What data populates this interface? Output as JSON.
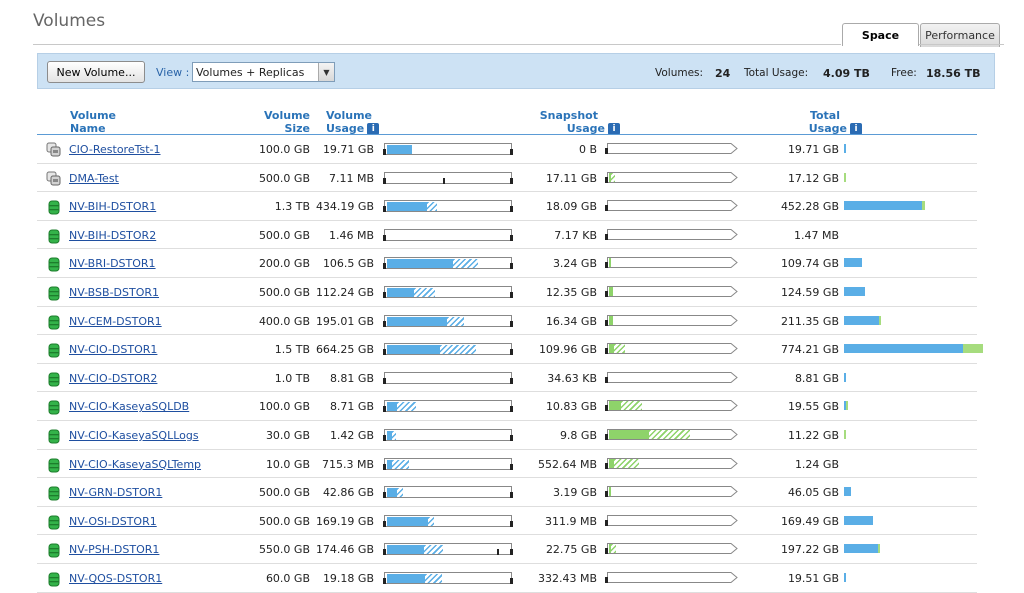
{
  "page": {
    "title": "Volumes"
  },
  "tabs": [
    {
      "label": "Space",
      "active": true
    },
    {
      "label": "Performance",
      "active": false
    }
  ],
  "toolbar": {
    "new_volume_label": "New Volume...",
    "view_label": "View :",
    "view_value": "Volumes + Replicas",
    "volumes_label": "Volumes:",
    "volumes_count": "24",
    "total_usage_label": "Total Usage:",
    "total_usage_value": "4.09 TB",
    "free_label": "Free:",
    "free_value": "18.56 TB"
  },
  "columns": {
    "name_l1": "Volume",
    "name_l2": "Name",
    "size_l1": "Volume",
    "size_l2": "Size",
    "usage_l1": "Volume",
    "usage_l2": "Usage",
    "snap_l1": "Snapshot",
    "snap_l2": "Usage",
    "total_l1": "Total",
    "total_l2": "Usage",
    "info_glyph": "i"
  },
  "colors": {
    "volume_bar": "#5aaee6",
    "snapshot_bar": "#8ed36a",
    "total_snapshot": "#a6dc7e",
    "header_text": "#2a73b8",
    "link": "#1f4fa0"
  },
  "rows": [
    {
      "icon": "replica-icon",
      "name": "CIO-RestoreTst-1",
      "size": "100.0 GB",
      "usage": "19.71 GB",
      "vol_used": 0.2,
      "vol_hatch": 0,
      "snap_usage": "0 B",
      "snap_used": 0,
      "snap_hatch": 0,
      "total": "19.71 GB",
      "total_vol": 0.017,
      "total_snap": 0
    },
    {
      "icon": "replica-icon",
      "name": "DMA-Test",
      "size": "500.0 GB",
      "usage": "7.11 MB",
      "vol_used": 0.0,
      "vol_hatch": 0,
      "vol_mark": 0.47,
      "snap_usage": "17.11 GB",
      "snap_used": 0.02,
      "snap_hatch": 0.03,
      "total": "17.12 GB",
      "total_vol": 0,
      "total_snap": 0.016
    },
    {
      "icon": "volume-icon",
      "name": "NV-BIH-DSTOR1",
      "size": "1.3 TB",
      "usage": "434.19 GB",
      "vol_used": 0.32,
      "vol_hatch": 0.08,
      "snap_usage": "18.09 GB",
      "snap_used": 0,
      "snap_hatch": 0,
      "total": "452.28 GB",
      "total_vol": 0.56,
      "total_snap": 0.016
    },
    {
      "icon": "volume-icon",
      "name": "NV-BIH-DSTOR2",
      "size": "500.0 GB",
      "usage": "1.46 MB",
      "vol_used": 0,
      "vol_hatch": 0,
      "snap_usage": "7.17 KB",
      "snap_used": 0,
      "snap_hatch": 0,
      "total": "1.47 MB",
      "total_vol": 0,
      "total_snap": 0
    },
    {
      "icon": "volume-icon",
      "name": "NV-BRI-DSTOR1",
      "size": "200.0 GB",
      "usage": "106.5 GB",
      "vol_used": 0.53,
      "vol_hatch": 0.2,
      "snap_usage": "3.24 GB",
      "snap_used": 0.02,
      "snap_hatch": 0,
      "total": "109.74 GB",
      "total_vol": 0.13,
      "total_snap": 0
    },
    {
      "icon": "volume-icon",
      "name": "NV-BSB-DSTOR1",
      "size": "500.0 GB",
      "usage": "112.24 GB",
      "vol_used": 0.22,
      "vol_hatch": 0.17,
      "snap_usage": "12.35 GB",
      "snap_used": 0.03,
      "snap_hatch": 0,
      "total": "124.59 GB",
      "total_vol": 0.15,
      "total_snap": 0
    },
    {
      "icon": "volume-icon",
      "name": "NV-CEM-DSTOR1",
      "size": "400.0 GB",
      "usage": "195.01 GB",
      "vol_used": 0.48,
      "vol_hatch": 0.14,
      "snap_usage": "16.34 GB",
      "snap_used": 0.03,
      "snap_hatch": 0,
      "total": "211.35 GB",
      "total_vol": 0.25,
      "total_snap": 0.016
    },
    {
      "icon": "volume-icon",
      "name": "NV-CIO-DSTOR1",
      "size": "1.5 TB",
      "usage": "664.25 GB",
      "vol_used": 0.43,
      "vol_hatch": 0.29,
      "snap_usage": "109.96 GB",
      "snap_used": 0.04,
      "snap_hatch": 0.09,
      "total": "774.21 GB",
      "total_vol": 0.85,
      "total_snap": 0.14
    },
    {
      "icon": "volume-icon",
      "name": "NV-CIO-DSTOR2",
      "size": "1.0 TB",
      "usage": "8.81 GB",
      "vol_used": 0,
      "vol_hatch": 0,
      "snap_usage": "34.63 KB",
      "snap_used": 0,
      "snap_hatch": 0,
      "total": "8.81 GB",
      "total_vol": 0.008,
      "total_snap": 0
    },
    {
      "icon": "volume-icon",
      "name": "NV-CIO-KaseyaSQLDB",
      "size": "100.0 GB",
      "usage": "8.71 GB",
      "vol_used": 0.08,
      "vol_hatch": 0.15,
      "snap_usage": "10.83 GB",
      "snap_used": 0.1,
      "snap_hatch": 0.17,
      "total": "19.55 GB",
      "total_vol": 0.008,
      "total_snap": 0.008
    },
    {
      "icon": "volume-icon",
      "name": "NV-CIO-KaseyaSQLLogs",
      "size": "30.0 GB",
      "usage": "1.42 GB",
      "vol_used": 0.04,
      "vol_hatch": 0.03,
      "snap_usage": "9.8 GB",
      "snap_used": 0.32,
      "snap_hatch": 0.33,
      "total": "11.22 GB",
      "total_vol": 0,
      "total_snap": 0.008
    },
    {
      "icon": "volume-icon",
      "name": "NV-CIO-KaseyaSQLTemp",
      "size": "10.0 GB",
      "usage": "715.3 MB",
      "vol_used": 0.04,
      "vol_hatch": 0.14,
      "snap_usage": "552.64 MB",
      "snap_used": 0.04,
      "snap_hatch": 0.2,
      "total": "1.24 GB",
      "total_vol": 0,
      "total_snap": 0
    },
    {
      "icon": "volume-icon",
      "name": "NV-GRN-DSTOR1",
      "size": "500.0 GB",
      "usage": "42.86 GB",
      "vol_used": 0.08,
      "vol_hatch": 0.05,
      "snap_usage": "3.19 GB",
      "snap_used": 0.02,
      "snap_hatch": 0,
      "total": "46.05 GB",
      "total_vol": 0.05,
      "total_snap": 0
    },
    {
      "icon": "volume-icon",
      "name": "NV-OSI-DSTOR1",
      "size": "500.0 GB",
      "usage": "169.19 GB",
      "vol_used": 0.33,
      "vol_hatch": 0.05,
      "snap_usage": "311.9 MB",
      "snap_used": 0,
      "snap_hatch": 0,
      "total": "169.49 GB",
      "total_vol": 0.21,
      "total_snap": 0
    },
    {
      "icon": "volume-icon",
      "name": "NV-PSH-DSTOR1",
      "size": "550.0 GB",
      "usage": "174.46 GB",
      "vol_used": 0.3,
      "vol_hatch": 0.15,
      "vol_mark": 0.9,
      "snap_usage": "22.75 GB",
      "snap_used": 0.02,
      "snap_hatch": 0.04,
      "total": "197.22 GB",
      "total_vol": 0.24,
      "total_snap": 0.016
    },
    {
      "icon": "volume-icon",
      "name": "NV-QOS-DSTOR1",
      "size": "60.0 GB",
      "usage": "19.18 GB",
      "vol_used": 0.31,
      "vol_hatch": 0.13,
      "snap_usage": "332.43 MB",
      "snap_used": 0,
      "snap_hatch": 0,
      "total": "19.51 GB",
      "total_vol": 0.016,
      "total_snap": 0
    }
  ]
}
